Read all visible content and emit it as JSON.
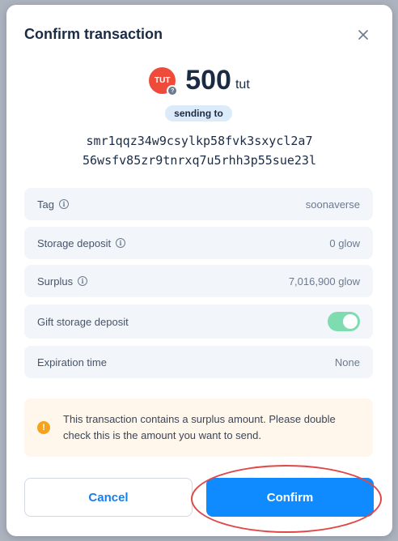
{
  "dialog": {
    "title": "Confirm transaction"
  },
  "amount": {
    "token_symbol": "TUT",
    "token_badge": "?",
    "value": "500",
    "unit": "tut"
  },
  "sending_label": "sending to",
  "address": {
    "line1": "smr1qqz34w9csylkp58fvk3sxycl2a7",
    "line2": "56wsfv85zr9tnrxq7u5rhh3p55sue23l"
  },
  "details": [
    {
      "label": "Tag",
      "value": "soonaverse",
      "info": true
    },
    {
      "label": "Storage deposit",
      "value": "0 glow",
      "info": true
    },
    {
      "label": "Surplus",
      "value": "7,016,900 glow",
      "info": true
    },
    {
      "label": "Gift storage deposit",
      "toggle_on": true
    },
    {
      "label": "Expiration time",
      "value": "None"
    }
  ],
  "warning": {
    "icon": "!",
    "text": "This transaction contains a surplus amount. Please double check this is the amount you want to send."
  },
  "buttons": {
    "cancel": "Cancel",
    "confirm": "Confirm"
  },
  "colors": {
    "primary": "#0f8bff",
    "token": "#ef4b3a",
    "toggle_on": "#7fdcb0",
    "warning": "#f7a21b",
    "highlight_ring": "#e04848"
  }
}
